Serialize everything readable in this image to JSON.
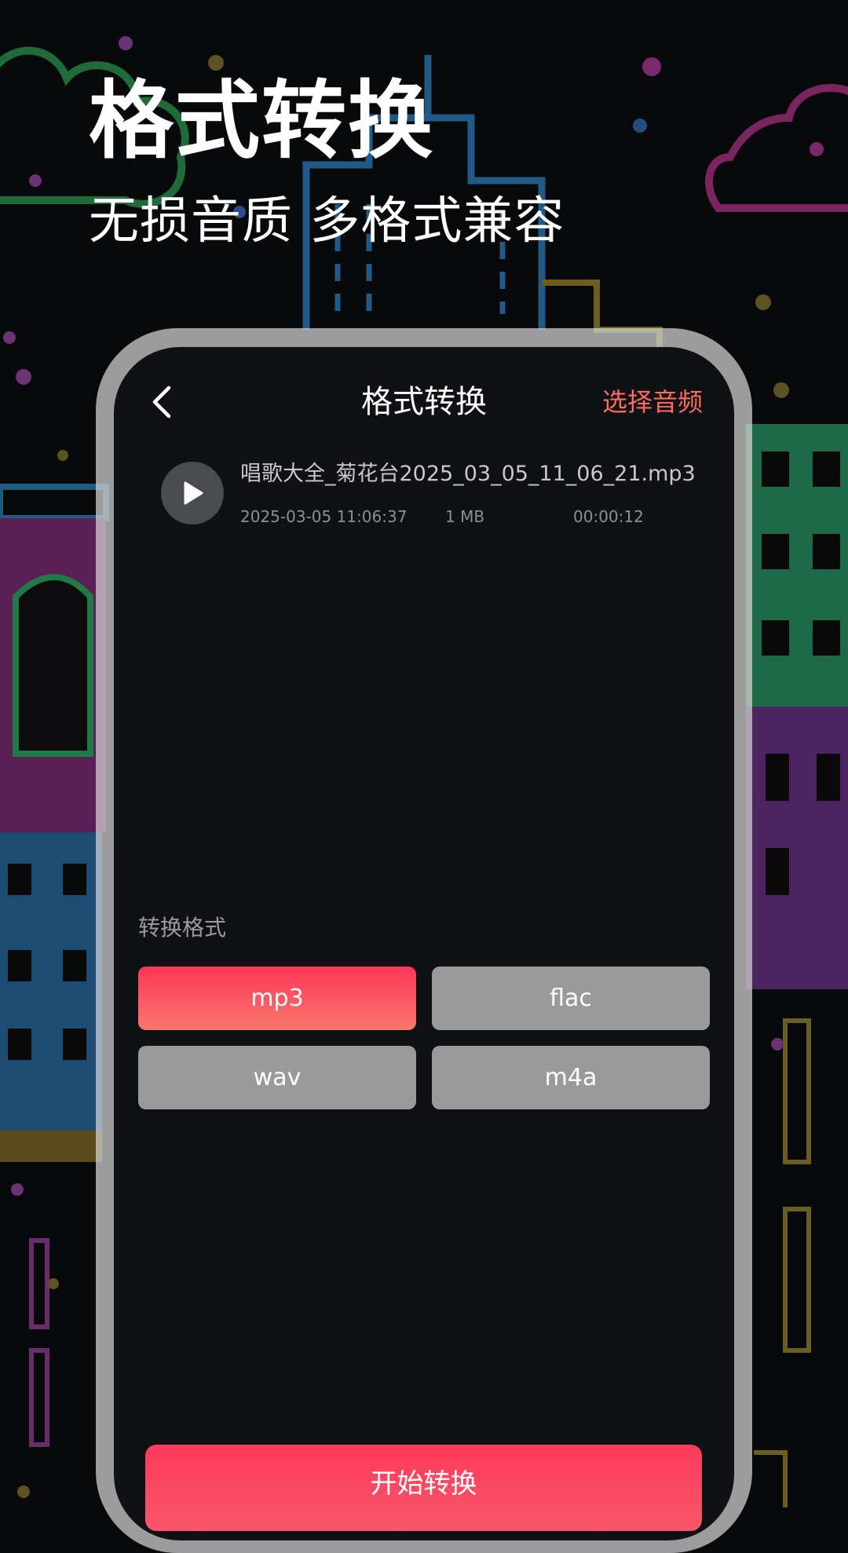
{
  "hero": {
    "headline": "格式转换",
    "subline": "无损音质 多格式兼容"
  },
  "screen": {
    "title": "格式转换",
    "select_audio": "选择音频",
    "back_icon": "chevron-left-icon"
  },
  "file": {
    "name": "唱歌大全_菊花台2025_03_05_11_06_21.mp3",
    "date": "2025-03-05 11:06:37",
    "size": "1 MB",
    "duration": "00:00:12",
    "play_icon": "play-icon"
  },
  "formats": {
    "label": "转换格式",
    "options": [
      "mp3",
      "flac",
      "wav",
      "m4a"
    ],
    "selected": "mp3"
  },
  "start_label": "开始转换",
  "colors": {
    "accent": "#fb6c5c",
    "button_gradient_start": "#fd3658",
    "button_gradient_end": "#f8786b",
    "inactive_button": "#9a9a9b",
    "screen_background": "#101115"
  }
}
